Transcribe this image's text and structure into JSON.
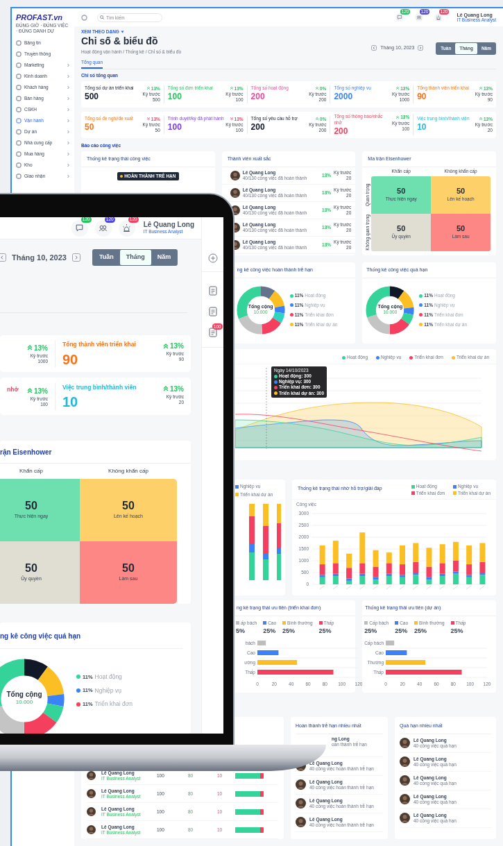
{
  "sidebar": {
    "logo": "PROFAST.vn",
    "tagline": "ĐÚNG GIỜ · ĐÚNG VIỆC · ĐÚNG DANH DỰ",
    "items": [
      {
        "label": "Bảng tin",
        "selected": false,
        "expandable": false
      },
      {
        "label": "Truyền thông",
        "selected": false,
        "expandable": false
      },
      {
        "label": "Marketing",
        "selected": false,
        "expandable": true
      },
      {
        "label": "Kinh doanh",
        "selected": false,
        "expandable": true
      },
      {
        "label": "Khách hàng",
        "selected": false,
        "expandable": true
      },
      {
        "label": "Bán hàng",
        "selected": false,
        "expandable": true
      },
      {
        "label": "CSKH",
        "selected": false,
        "expandable": true
      },
      {
        "label": "Vận hành",
        "selected": true,
        "expandable": true
      },
      {
        "label": "Dự án",
        "selected": false,
        "expandable": true
      },
      {
        "label": "Nhà cung cấp",
        "selected": false,
        "expandable": true
      },
      {
        "label": "Mua hàng",
        "selected": false,
        "expandable": true
      },
      {
        "label": "Kho",
        "selected": false,
        "expandable": true
      },
      {
        "label": "Giao nhận",
        "selected": false,
        "expandable": true
      }
    ]
  },
  "topbar": {
    "search_placeholder": "Tìm kiếm",
    "notifications": [
      {
        "count": "120",
        "color": "#22c55e"
      },
      {
        "count": "120",
        "color": "#4f46e5"
      },
      {
        "count": "120",
        "color": "#f43f5e"
      }
    ],
    "user": {
      "name": "Lê Quang Long",
      "role": "IT Business Analyst"
    }
  },
  "header": {
    "view_mode": "XEM THEO DẠNG",
    "title": "Chỉ số & biểu đồ",
    "breadcrumb": "Hoạt động vận hành / Thống kê / Chỉ số & biểu đồ",
    "period": "Tháng 10, 2023",
    "ranges": [
      {
        "label": "Tuần",
        "selected": false
      },
      {
        "label": "Tháng",
        "selected": true
      },
      {
        "label": "Năm",
        "selected": false
      }
    ]
  },
  "tabs": [
    {
      "label": "Tổng quan",
      "selected": true
    }
  ],
  "overview_title": "Chỉ số tổng quan",
  "stats": [
    {
      "label": "Tổng số dự án triển khai",
      "value": "500",
      "color": "#111827",
      "kind": "up",
      "change": "13%",
      "prev_label": "Kỳ trước",
      "prev": "500"
    },
    {
      "label": "Tổng số đơn triển khai",
      "value": "100",
      "color": "#22c55e",
      "kind": "up",
      "change": "13%",
      "prev_label": "Kỳ trước",
      "prev": "100"
    },
    {
      "label": "Tổng số hoạt động",
      "value": "200",
      "color": "#ec4899",
      "kind": "up",
      "change": "0%",
      "prev_label": "Kỳ trước",
      "prev": "200"
    },
    {
      "label": "Tổng số nghiệp vụ",
      "value": "2000",
      "color": "#3b82f6",
      "kind": "up",
      "change": "13%",
      "prev_label": "Kỳ trước",
      "prev": "1000"
    },
    {
      "label": "Tổng thành viên triển khai",
      "value": "90",
      "color": "#f97316",
      "kind": "up",
      "change": "13%",
      "prev_label": "Kỳ trước",
      "prev": "90"
    },
    {
      "label": "Tổng số đề nghị/đề xuất",
      "value": "50",
      "color": "#f97316",
      "kind": "down",
      "change": "13%",
      "prev_label": "Kỳ trước",
      "prev": "50"
    },
    {
      "label": "Trình duyệt/ký đã phát hành",
      "value": "100",
      "color": "#7c3aed",
      "kind": "down",
      "change": "13%",
      "prev_label": "Kỳ trước",
      "prev": "100"
    },
    {
      "label": "Tổng số yêu cầu hỗ trợ",
      "value": "200",
      "color": "#111827",
      "kind": "up",
      "change": "0%",
      "prev_label": "Kỳ trước",
      "prev": "200"
    },
    {
      "label": "Tổng số thông báo/nhắc nhở",
      "value": "200",
      "color": "#f43f5e",
      "kind": "up",
      "change": "13%",
      "prev_label": "Kỳ trước",
      "prev": "100"
    },
    {
      "label": "Việc trung bình/thành viên",
      "value": "10",
      "color": "#22b8d8",
      "kind": "up",
      "change": "13%",
      "prev_label": "Kỳ trước",
      "prev": "20"
    }
  ],
  "report_title": "Báo cáo công việc",
  "status_card": {
    "title": "Thống kê trạng thái công việc",
    "tooltip": "HOÀN THÀNH TRỄ HẠN"
  },
  "top_members": {
    "title": "Thành viên xuất sắc",
    "rows": [
      {
        "name": "Lê Quang Long",
        "detail": "40/130 công việc đã hoàn thành",
        "change": "13%",
        "prev_label": "Kỳ trước",
        "prev": "20"
      },
      {
        "name": "Lê Quang Long",
        "detail": "40/130 công việc đã hoàn thành",
        "change": "13%",
        "prev_label": "Kỳ trước",
        "prev": "20"
      },
      {
        "name": "Lê Quang Long",
        "detail": "40/130 công việc đã hoàn thành",
        "change": "13%",
        "prev_label": "Kỳ trước",
        "prev": "20"
      },
      {
        "name": "Lê Quang Long",
        "detail": "40/130 công việc đã hoàn thành",
        "change": "13%",
        "prev_label": "Kỳ trước",
        "prev": "20"
      },
      {
        "name": "Lê Quang Long",
        "detail": "40/130 công việc đã hoàn thành",
        "change": "13%",
        "prev_label": "Kỳ trước",
        "prev": "20"
      }
    ]
  },
  "eisenhower": {
    "title": "Ma trận Eisenhower",
    "columns": [
      "Khẩn cấp",
      "Không khẩn cấp"
    ],
    "rows": [
      "Quan trọng",
      "Không quan trọng"
    ],
    "cells": [
      {
        "value": "50",
        "label": "Thực hiện ngay",
        "color": "#6ee0b0"
      },
      {
        "value": "50",
        "label": "Lên kế hoạch",
        "color": "#fdd06a"
      },
      {
        "value": "50",
        "label": "Ủy quyền",
        "color": "#e0ddd3"
      },
      {
        "value": "50",
        "label": "Làm sau",
        "color": "#fd8785"
      }
    ]
  },
  "donut_cards": [
    {
      "title": "ng kê công việc hoàn thành trễ hạn",
      "center": "Tổng cộng",
      "total": "10.000",
      "legend": [
        {
          "percent": "11%",
          "label": "Hoạt động",
          "color": "#34d399"
        },
        {
          "percent": "11%",
          "label": "Nghiệp vụ",
          "color": "#3b82f6"
        },
        {
          "percent": "11%",
          "label": "Triển khai đơn",
          "color": "#f43f5e"
        },
        {
          "percent": "11%",
          "label": "Triển khai dự án",
          "color": "#fbbf24"
        }
      ]
    },
    {
      "title": "Thống kê công việc quá hạn",
      "center": "Tổng cộng",
      "total": "10.000",
      "legend": [
        {
          "percent": "11%",
          "label": "Hoạt động",
          "color": "#34d399"
        },
        {
          "percent": "11%",
          "label": "Nghiệp vụ",
          "color": "#3b82f6"
        },
        {
          "percent": "11%",
          "label": "Triển khai đơn",
          "color": "#f43f5e"
        },
        {
          "percent": "11%",
          "label": "Triển khai dự án",
          "color": "#fbbf24"
        }
      ]
    }
  ],
  "trend_chart": {
    "legend": [
      {
        "label": "Hoạt động",
        "color": "#34d399"
      },
      {
        "label": "Nghiệp vụ",
        "color": "#3b82f6"
      },
      {
        "label": "Triển khai đơn",
        "color": "#f43f5e"
      },
      {
        "label": "Triển khai dự án",
        "color": "#fbbf24"
      }
    ],
    "tooltip": {
      "title": "Ngày 14/10/2023",
      "lines": [
        {
          "text": "Hoạt động: 300",
          "color": "#34d399"
        },
        {
          "text": "Nghiệp vụ: 300",
          "color": "#3b82f6"
        },
        {
          "text": "Triển khai đơn: 300",
          "color": "#f43f5e"
        },
        {
          "text": "Triển khai dự án: 300",
          "color": "#fbbf24"
        }
      ]
    }
  },
  "support_left": {
    "legend": [
      {
        "label": "Nghiệp vụ",
        "color": "#3b82f6"
      },
      {
        "label": "Triển khai dự án",
        "color": "#fbbf24"
      }
    ]
  },
  "support_chart": {
    "title": "Thống kê trạng thái nhờ hỗ trợ/giải đáp",
    "chart_data": {
      "type": "bar",
      "stacked": true,
      "grid": true,
      "ylabel": "Công việc",
      "ylim": [
        0,
        3000
      ],
      "yticks": [
        0,
        500,
        1000,
        1500,
        2000,
        2500,
        3000
      ],
      "series": [
        {
          "name": "Hoạt động",
          "color": "#34d399",
          "values": [
            300,
            350,
            150,
            350,
            200,
            350,
            300,
            400,
            200,
            350,
            450,
            300,
            400
          ]
        },
        {
          "name": "Nghiệp vụ",
          "color": "#3b82f6",
          "values": [
            100,
            100,
            100,
            100,
            100,
            100,
            100,
            100,
            100,
            100,
            100,
            100,
            100
          ]
        },
        {
          "name": "Triển khai đơn",
          "color": "#f43f5e",
          "values": [
            450,
            450,
            450,
            450,
            450,
            450,
            450,
            450,
            450,
            450,
            450,
            450,
            450
          ]
        },
        {
          "name": "Triển khai dự án",
          "color": "#fbbf24",
          "values": [
            800,
            950,
            600,
            1300,
            700,
            450,
            800,
            800,
            800,
            800,
            800,
            800,
            800
          ]
        }
      ]
    }
  },
  "priority_cards": [
    {
      "title": "ng kê trạng thái ưu tiên (triển khai đơn)",
      "legend": [
        {
          "label": "ấp bách",
          "percent": "5%",
          "color": "#bdbdbd"
        },
        {
          "label": "Cao",
          "percent": "25%",
          "color": "#3b82f6"
        },
        {
          "label": "Bình thường",
          "percent": "25%",
          "color": "#fbbf24"
        },
        {
          "label": "Thấp",
          "percent": "25%",
          "color": "#f43f5e"
        }
      ],
      "chart_data": {
        "type": "bar",
        "orientation": "horizontal",
        "grid": true,
        "categories": [
          "bách",
          "Cao",
          "ường",
          "Thấp"
        ],
        "values": [
          10,
          25,
          47,
          90
        ],
        "xlim": [
          0,
          120
        ],
        "xticks": [
          0,
          20,
          40,
          60,
          80,
          100,
          120
        ]
      }
    },
    {
      "title": "Thống kê trạng thái ưu tiên (dự án)",
      "legend": [
        {
          "label": "Cấp bách",
          "percent": "25%",
          "color": "#bdbdbd"
        },
        {
          "label": "Cao",
          "percent": "25%",
          "color": "#3b82f6"
        },
        {
          "label": "Bình thường",
          "percent": "25%",
          "color": "#fbbf24"
        },
        {
          "label": "Thấp",
          "percent": "25%",
          "color": "#f43f5e"
        }
      ],
      "chart_data": {
        "type": "bar",
        "orientation": "horizontal",
        "grid": true,
        "categories": [
          "Cấp bách",
          "Cao",
          "Thường",
          "Thấp"
        ],
        "values": [
          10,
          25,
          47,
          90
        ],
        "xlim": [
          0,
          120
        ],
        "xticks": [
          0,
          20,
          40,
          60,
          80,
          100,
          120
        ]
      }
    }
  ],
  "ranking_table": {
    "rows": [
      {
        "name": "Lê Quang Long",
        "role": "IT Business Analyst",
        "total": "100",
        "done": "80",
        "late": "10",
        "level": 0.88
      },
      {
        "name": "Lê Quang Long",
        "role": "IT Business Analyst",
        "total": "100",
        "done": "80",
        "late": "10",
        "level": 0.88
      },
      {
        "name": "Lê Quang Long",
        "role": "IT Business Analyst",
        "total": "100",
        "done": "80",
        "late": "10",
        "level": 0.88
      },
      {
        "name": "Lê Quang Long",
        "role": "IT Business Analyst",
        "total": "100",
        "done": "80",
        "late": "10",
        "level": 0.88
      }
    ]
  },
  "late_list": {
    "title": "Hoàn thành trễ hạn nhiều nhất",
    "rows": [
      {
        "kind": "cut",
        "name": "ng Long",
        "detail": "oàn thành trễ hạn"
      },
      {
        "kind": "full",
        "name": "Lê Quang Long",
        "detail": "40 công việc hoàn thành trễ hạn"
      },
      {
        "kind": "full",
        "name": "Lê Quang Long",
        "detail": "40 công việc hoàn thành trễ hạn"
      },
      {
        "kind": "full",
        "name": "Lê Quang Long",
        "detail": "40 công việc hoàn thành trễ hạn"
      },
      {
        "kind": "full",
        "name": "Lê Quang Long",
        "detail": "40 công việc hoàn thành trễ hạn"
      }
    ]
  },
  "overdue_list": {
    "title": "Quá hạn nhiều nhất",
    "rows": [
      {
        "kind": "full",
        "name": "Lê Quang Long",
        "detail": "40 công việc quá hạn"
      },
      {
        "kind": "full",
        "name": "Lê Quang Long",
        "detail": "40 công việc quá hạn"
      },
      {
        "kind": "full",
        "name": "Lê Quang Long",
        "detail": "40 công việc quá hạn"
      },
      {
        "kind": "full",
        "name": "Lê Quang Long",
        "detail": "40 công việc quá hạn"
      },
      {
        "kind": "full",
        "name": "Lê Quang Long",
        "detail": "40 công việc quá hạn"
      }
    ]
  },
  "laptop": {
    "notifications": [
      {
        "count": "120",
        "color": "#22c55e"
      },
      {
        "count": "120",
        "color": "#4f46e5"
      },
      {
        "count": "120",
        "color": "#f43f5e"
      }
    ],
    "user": {
      "name": "Lê Quang Long",
      "role": "IT Business Analyst"
    },
    "period": "Tháng 10, 2023",
    "ranges": [
      {
        "label": "Tuần",
        "selected": false
      },
      {
        "label": "Tháng",
        "selected": true
      },
      {
        "label": "Năm",
        "selected": false
      }
    ],
    "rail_badge": "100",
    "stat_rows": [
      {
        "cells": [
          {
            "kind": "up",
            "change": "13%",
            "prev_label": "Kỳ trước",
            "prev": "1000"
          },
          {
            "label": "Tổng thành viên triển khai",
            "value": "90",
            "color": "#f97316",
            "kind": "up",
            "change": "13%",
            "prev_label": "Kỳ trước",
            "prev": "90"
          }
        ]
      },
      {
        "cells": [
          {
            "label": "nhở",
            "color": "#f43f5e",
            "kind": "up",
            "change": "13%",
            "prev_label": "Kỳ trước",
            "prev": "100"
          },
          {
            "label": "Việc trung bình/thành viên",
            "value": "10",
            "color": "#22b8d8",
            "kind": "up",
            "change": "13%",
            "prev_label": "Kỳ trước",
            "prev": "20"
          }
        ]
      }
    ],
    "eisenhower": {
      "title": "rận Eisenhower",
      "columns": [
        "Khẩn cấp",
        "Không khẩn cấp"
      ],
      "cells": [
        {
          "value": "50",
          "label": "Thực hiện ngay",
          "color": "#6ee0b0"
        },
        {
          "value": "50",
          "label": "Lên kế hoạch",
          "color": "#fdd06a"
        },
        {
          "value": "50",
          "label": "Ủy quyền",
          "color": "#e0ddd3"
        },
        {
          "value": "50",
          "label": "Làm sau",
          "color": "#fd8785"
        }
      ]
    },
    "overdue": {
      "title": "ng kê công việc quá hạn",
      "center": "Tổng cộng",
      "total": "10.000",
      "legend": [
        {
          "percent": "11%",
          "label": "Hoạt động",
          "color": "#34d399"
        },
        {
          "percent": "11%",
          "label": "Nghiệp vụ",
          "color": "#3b82f6"
        },
        {
          "percent": "11%",
          "label": "Triển khai đơn",
          "color": "#f43f5e"
        }
      ]
    }
  }
}
